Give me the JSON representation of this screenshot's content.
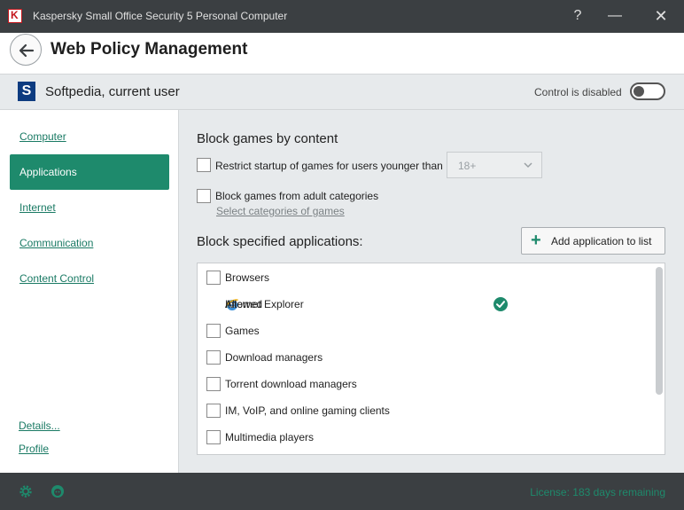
{
  "window": {
    "logo_letter": "K",
    "title": "Kaspersky Small Office Security 5 Personal Computer",
    "help_label": "?",
    "minimize_label": "—",
    "close_label": "✕"
  },
  "header": {
    "title": "Web Policy Management"
  },
  "userbar": {
    "logo_letter": "S",
    "user_name": "Softpedia, current user",
    "control_label": "Control is disabled",
    "control_enabled": false
  },
  "sidebar": {
    "items": [
      {
        "label": "Computer",
        "active": false
      },
      {
        "label": "Applications",
        "active": true
      },
      {
        "label": "Internet",
        "active": false
      },
      {
        "label": "Communication",
        "active": false
      },
      {
        "label": "Content Control",
        "active": false
      }
    ],
    "details_link": "Details...",
    "profile_link": "Profile"
  },
  "main": {
    "games_section": {
      "title": "Block games by content",
      "restrict_label": "Restrict startup of games for users younger than",
      "restrict_checked": false,
      "age_value": "18+",
      "adult_label": "Block games from adult categories",
      "adult_checked": false,
      "categories_link": "Select categories of games"
    },
    "apps_section": {
      "title": "Block specified applications:",
      "add_button_label": "Add application to list",
      "list": {
        "browsers": "Browsers",
        "ie": "Internet Explorer",
        "ie_status": "Allowed",
        "games": "Games",
        "download_managers": "Download managers",
        "torrent": "Torrent download managers",
        "im": "IM, VoIP, and online gaming clients",
        "multimedia": "Multimedia players"
      }
    }
  },
  "footer": {
    "license": "License: 183 days remaining"
  },
  "colors": {
    "accent": "#1e8a6c",
    "titlebar": "#3b3f42",
    "panel": "#e7eaec"
  }
}
